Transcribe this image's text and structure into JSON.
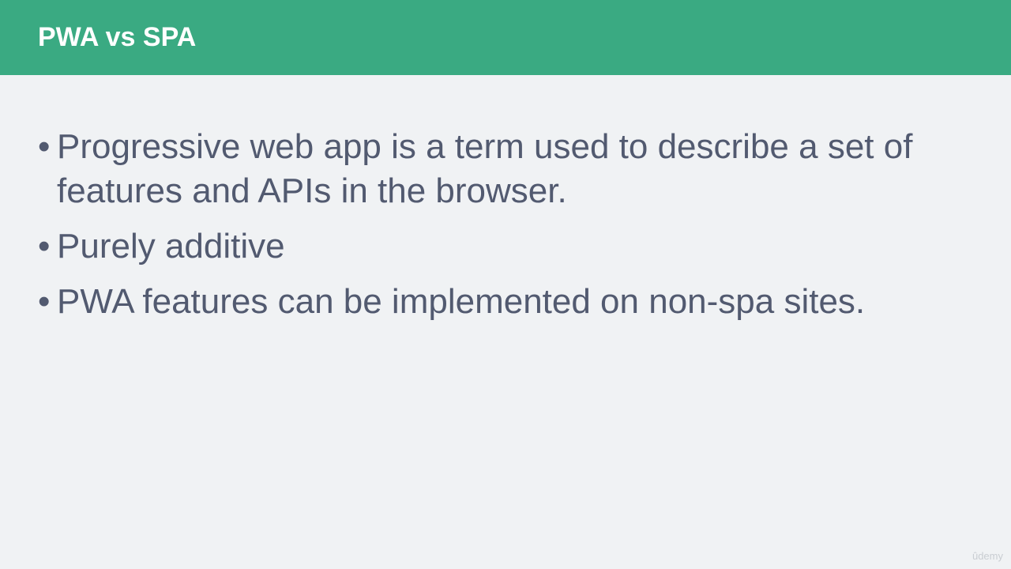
{
  "slide": {
    "title": "PWA vs SPA",
    "bullets": [
      {
        "text": "Progressive web app is a term used to describe a set of features and APIs in the browser."
      },
      {
        "text": "Purely additive"
      },
      {
        "text": "PWA features can be implemented on non-spa sites."
      }
    ],
    "bullet_glyph": "•",
    "watermark": "ûdemy"
  },
  "colors": {
    "header_background": "#3aaa82",
    "title_text": "#ffffff",
    "slide_background": "#f0f2f4",
    "body_text": "#525a70"
  }
}
